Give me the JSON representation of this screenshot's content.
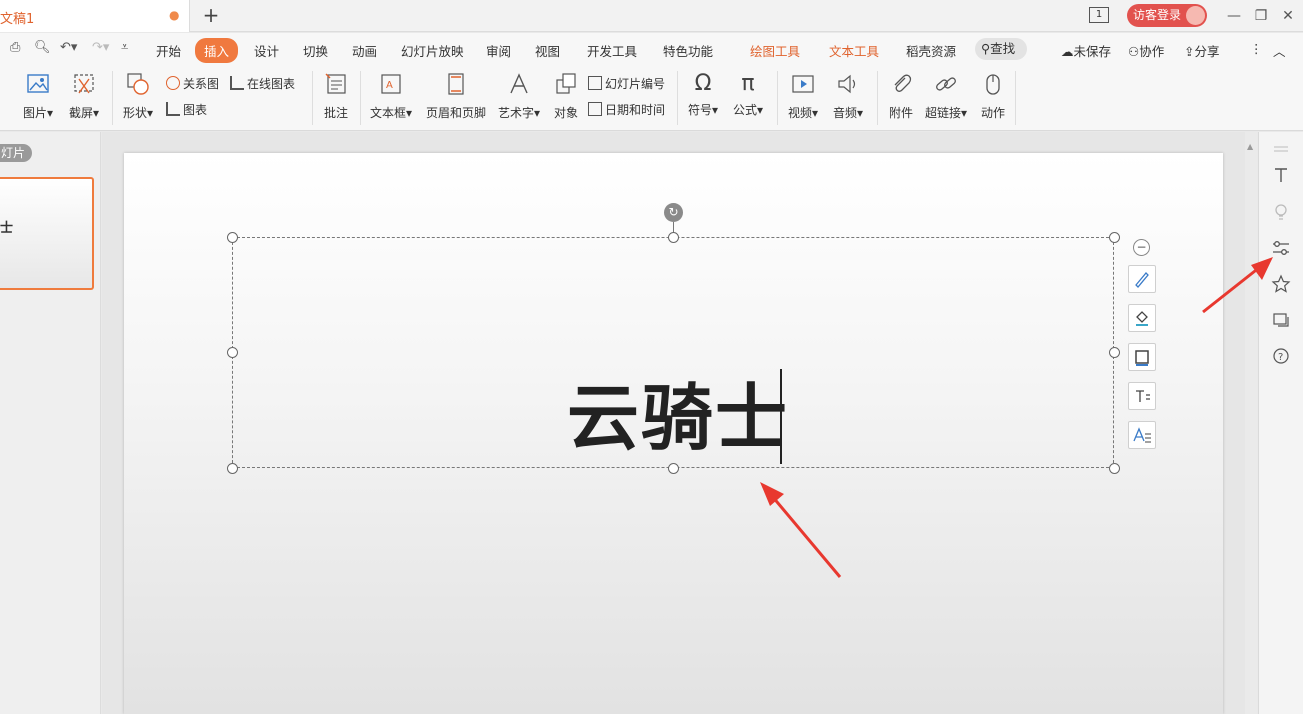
{
  "titlebar": {
    "doc_name": "文稿1",
    "modified_dot": "●",
    "new_tab": "+",
    "window_count": "1",
    "login_label": "访客登录"
  },
  "menu": {
    "items": [
      "开始",
      "插入",
      "设计",
      "切换",
      "动画",
      "幻灯片放映",
      "审阅",
      "视图",
      "开发工具",
      "特色功能"
    ],
    "active": "插入",
    "context_tabs": [
      "绘图工具",
      "文本工具"
    ],
    "extra": "稻壳资源",
    "search": "查找",
    "unsaved": "未保存",
    "collaborate": "协作",
    "share": "分享"
  },
  "ribbon": {
    "picture": "图片",
    "screenshot": "截屏",
    "shape": "形状",
    "relation": "关系图",
    "chart": "图表",
    "online_chart": "在线图表",
    "comment": "批注",
    "textbox": "文本框",
    "header_footer": "页眉和页脚",
    "wordart": "艺术字",
    "object": "对象",
    "slide_number": "幻灯片编号",
    "date_time": "日期和时间",
    "symbol": "符号",
    "formula": "公式",
    "video": "视频",
    "audio": "音频",
    "attachment": "附件",
    "hyperlink": "超链接",
    "action": "动作"
  },
  "left_panel": {
    "badge": "灯片",
    "thumb_text": "士"
  },
  "slide": {
    "text": "云骑士"
  },
  "colors": {
    "accent": "#f0793f",
    "login": "#e2524e",
    "arrow": "#e8382f"
  }
}
